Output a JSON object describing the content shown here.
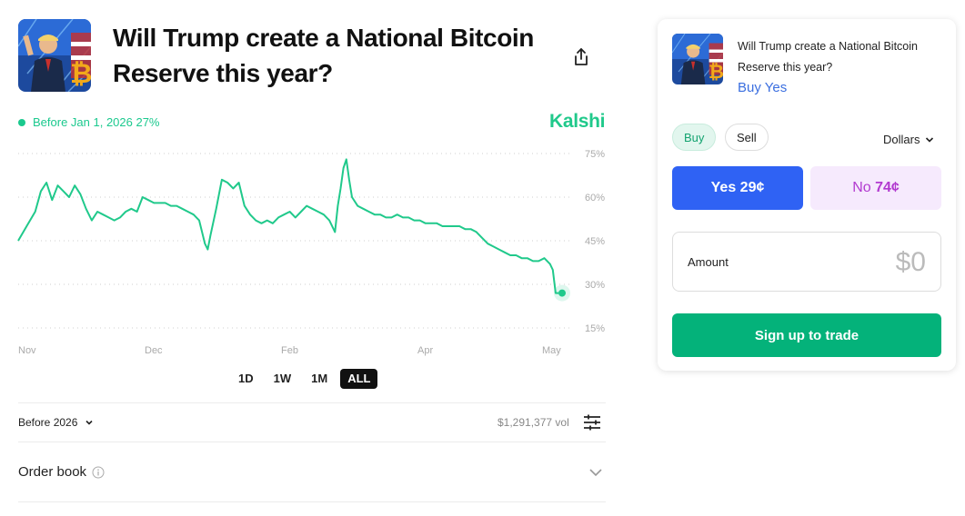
{
  "market": {
    "title": "Will Trump create a National Bitcoin Reserve this year?",
    "brand": "Kalshi",
    "legend_label": "Before Jan 1, 2026 27%"
  },
  "colors": {
    "accent": "#20c98b",
    "yes": "#2f62f4",
    "no": "#b23ad0",
    "signup": "#04b27a"
  },
  "icons": {
    "share": "share-icon",
    "settings": "sliders-icon",
    "info": "info-icon",
    "chevron": "chevron-down-icon"
  },
  "chart_data": {
    "type": "line",
    "x_ticks": [
      "Nov",
      "Dec",
      "Feb",
      "Apr",
      "May"
    ],
    "y_ticks": [
      "75%",
      "60%",
      "45%",
      "30%",
      "15%"
    ],
    "ylim": [
      15,
      75
    ],
    "grid": true,
    "series": [
      {
        "values": [
          [
            0,
            45
          ],
          [
            3,
            50
          ],
          [
            6,
            55
          ],
          [
            8,
            62
          ],
          [
            10,
            65
          ],
          [
            12,
            59
          ],
          [
            14,
            64
          ],
          [
            16,
            62
          ],
          [
            18,
            60
          ],
          [
            20,
            64
          ],
          [
            22,
            61
          ],
          [
            24,
            56
          ],
          [
            26,
            52
          ],
          [
            28,
            55
          ],
          [
            30,
            54
          ],
          [
            32,
            53
          ],
          [
            34,
            52
          ],
          [
            36,
            53
          ],
          [
            38,
            55
          ],
          [
            40,
            56
          ],
          [
            42,
            55
          ],
          [
            44,
            60
          ],
          [
            46,
            59
          ],
          [
            48,
            58
          ],
          [
            50,
            58
          ],
          [
            52,
            58
          ],
          [
            54,
            57
          ],
          [
            56,
            57
          ],
          [
            58,
            56
          ],
          [
            60,
            55
          ],
          [
            62,
            54
          ],
          [
            64,
            52
          ],
          [
            66,
            44
          ],
          [
            67,
            42
          ],
          [
            68,
            47
          ],
          [
            70,
            56
          ],
          [
            72,
            66
          ],
          [
            74,
            65
          ],
          [
            76,
            63
          ],
          [
            78,
            65
          ],
          [
            80,
            57
          ],
          [
            82,
            54
          ],
          [
            84,
            52
          ],
          [
            86,
            51
          ],
          [
            88,
            52
          ],
          [
            90,
            51
          ],
          [
            92,
            53
          ],
          [
            94,
            54
          ],
          [
            96,
            55
          ],
          [
            98,
            53
          ],
          [
            100,
            55
          ],
          [
            102,
            57
          ],
          [
            104,
            56
          ],
          [
            106,
            55
          ],
          [
            108,
            54
          ],
          [
            110,
            52
          ],
          [
            112,
            48
          ],
          [
            113,
            57
          ],
          [
            114,
            63
          ],
          [
            115,
            70
          ],
          [
            116,
            73
          ],
          [
            117,
            66
          ],
          [
            118,
            60
          ],
          [
            120,
            57
          ],
          [
            122,
            56
          ],
          [
            124,
            55
          ],
          [
            126,
            54
          ],
          [
            128,
            54
          ],
          [
            130,
            53
          ],
          [
            132,
            53
          ],
          [
            134,
            54
          ],
          [
            136,
            53
          ],
          [
            138,
            53
          ],
          [
            140,
            52
          ],
          [
            142,
            52
          ],
          [
            144,
            51
          ],
          [
            146,
            51
          ],
          [
            148,
            51
          ],
          [
            150,
            50
          ],
          [
            152,
            50
          ],
          [
            154,
            50
          ],
          [
            156,
            50
          ],
          [
            158,
            49
          ],
          [
            160,
            49
          ],
          [
            162,
            48
          ],
          [
            164,
            46
          ],
          [
            166,
            44
          ],
          [
            168,
            43
          ],
          [
            170,
            42
          ],
          [
            172,
            41
          ],
          [
            174,
            40
          ],
          [
            176,
            40
          ],
          [
            178,
            39
          ],
          [
            180,
            39
          ],
          [
            182,
            38
          ],
          [
            184,
            38
          ],
          [
            186,
            39
          ],
          [
            188,
            37
          ],
          [
            189,
            35
          ],
          [
            190,
            27
          ],
          [
            191,
            27
          ]
        ]
      }
    ]
  },
  "ranges": [
    "1D",
    "1W",
    "1M",
    "ALL"
  ],
  "footer": {
    "expiry": "Before 2026",
    "volume": "$1,291,377 vol",
    "order_book": "Order book"
  },
  "card": {
    "title": "Will Trump create a National Bitcoin Reserve this year?",
    "action": "Buy Yes",
    "buy": "Buy",
    "sell": "Sell",
    "currency": "Dollars",
    "yes_label": "Yes",
    "yes_price": "29¢",
    "no_label": "No",
    "no_price": "74¢",
    "amount_label": "Amount",
    "amount_value": "$0",
    "signup": "Sign up to trade"
  }
}
